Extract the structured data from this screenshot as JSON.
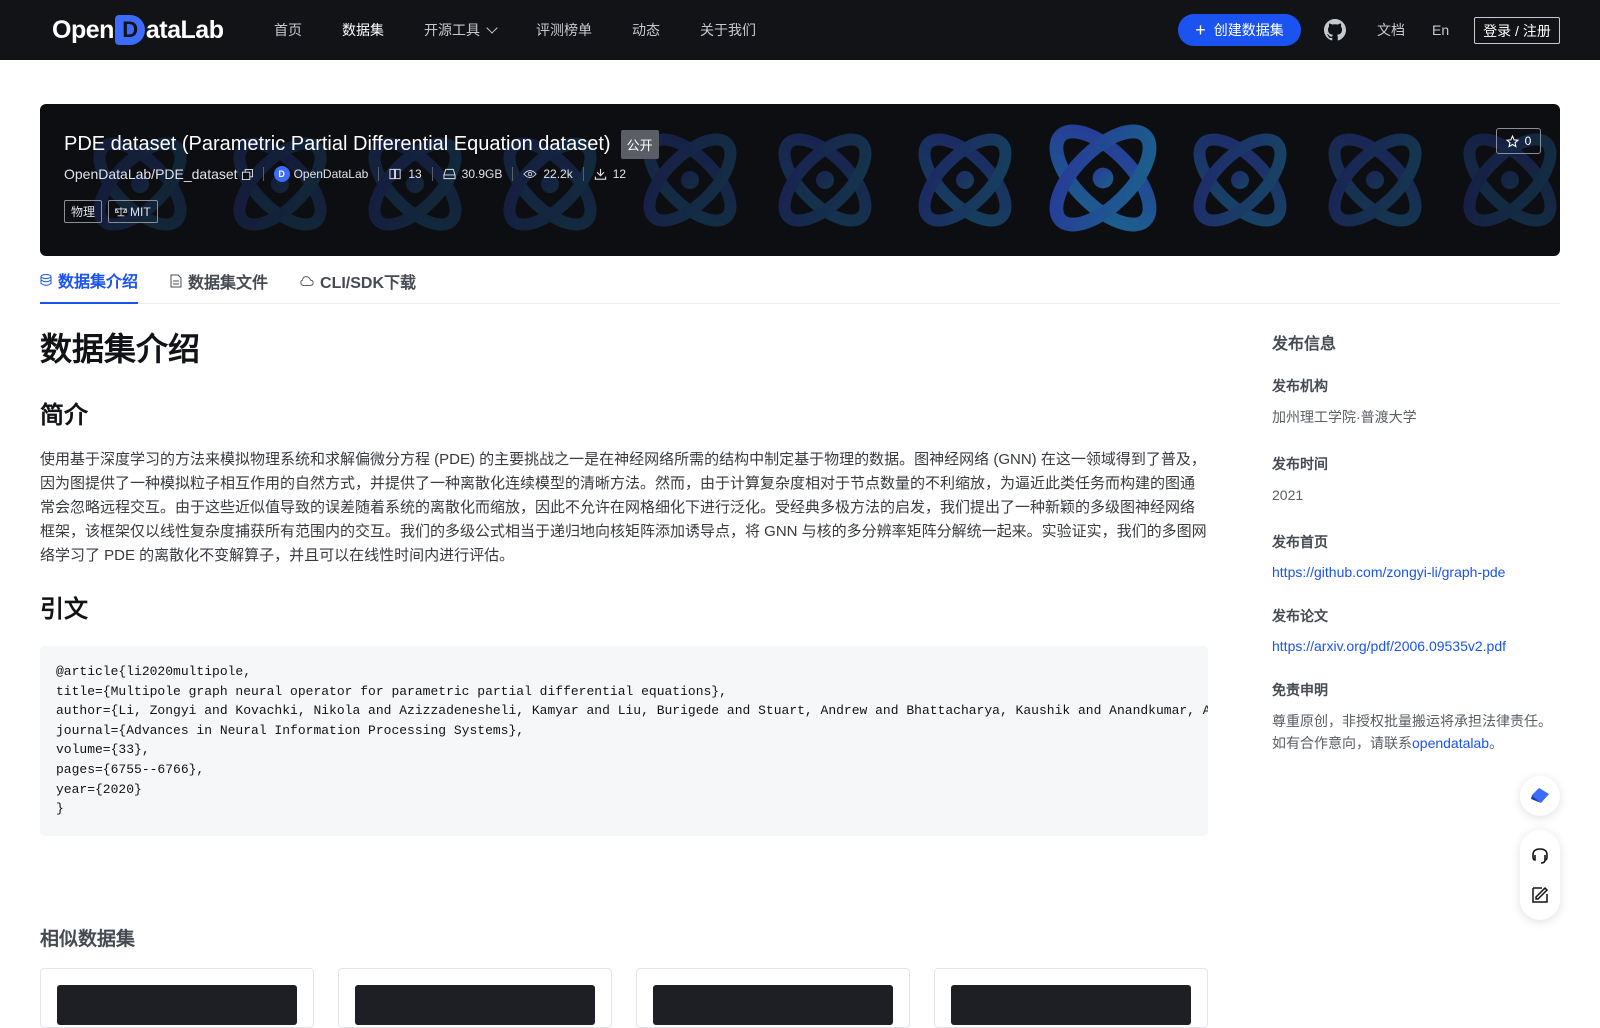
{
  "brand": {
    "logo_pre": "Open",
    "logo_mark": "D",
    "logo_post": "ataLab"
  },
  "nav": {
    "items": [
      {
        "label": "首页",
        "active": false
      },
      {
        "label": "数据集",
        "active": true
      },
      {
        "label": "开源工具",
        "active": false,
        "dropdown": true
      },
      {
        "label": "评测榜单",
        "active": false
      },
      {
        "label": "动态",
        "active": false
      },
      {
        "label": "关于我们",
        "active": false
      }
    ],
    "create_label": "创建数据集",
    "docs_label": "文档",
    "lang_label": "En",
    "login_label": "登录 / 注册"
  },
  "dataset": {
    "title": "PDE dataset (Parametric Partial Differential Equation dataset)",
    "visibility": "公开",
    "repo": "OpenDataLab/PDE_dataset",
    "org": "OpenDataLab",
    "file_count": "13",
    "size": "30.9GB",
    "views": "22.2k",
    "downloads": "12",
    "stars": "0",
    "tags": [
      "物理",
      "MIT"
    ]
  },
  "tabs": [
    {
      "label": "数据集介绍",
      "icon": "database-icon",
      "active": true
    },
    {
      "label": "数据集文件",
      "icon": "file-icon",
      "active": false
    },
    {
      "label": "CLI/SDK下载",
      "icon": "cloud-icon",
      "active": false
    }
  ],
  "main": {
    "heading": "数据集介绍",
    "intro_heading": "简介",
    "intro_text": "使用基于深度学习的方法来模拟物理系统和求解偏微分方程 (PDE) 的主要挑战之一是在神经网络所需的结构中制定基于物理的数据。图神经网络 (GNN) 在这一领域得到了普及，因为图提供了一种模拟粒子相互作用的自然方式，并提供了一种离散化连续模型的清晰方法。然而，由于计算复杂度相对于节点数量的不利缩放，为逼近此类任务而构建的图通常会忽略远程交互。由于这些近似值导致的误差随着系统的离散化而缩放，因此不允许在网格细化下进行泛化。受经典多极方法的启发，我们提出了一种新颖的多级图神经网络框架，该框架仅以线性复杂度捕获所有范围内的交互。我们的多级公式相当于递归地向核矩阵添加诱导点，将 GNN 与核的多分辨率矩阵分解统一起来。实验证实，我们的多图网络学习了 PDE 的离散化不变解算子，并且可以在线性时间内进行评估。",
    "citation_heading": "引文",
    "citation": "@article{li2020multipole,\ntitle={Multipole graph neural operator for parametric partial differential equations},\nauthor={Li, Zongyi and Kovachki, Nikola and Azizzadenesheli, Kamyar and Liu, Burigede and Stuart, Andrew and Bhattacharya, Kaushik and Anandkumar, Anima},\njournal={Advances in Neural Information Processing Systems},\nvolume={33},\npages={6755--6766},\nyear={2020}\n}",
    "similar_heading": "相似数据集"
  },
  "sidebar": {
    "title": "发布信息",
    "publisher_label": "发布机构",
    "publisher": "加州理工学院·普渡大学",
    "time_label": "发布时间",
    "time": "2021",
    "homepage_label": "发布首页",
    "homepage": "https://github.com/zongyi-li/graph-pde",
    "paper_label": "发布论文",
    "paper": "https://arxiv.org/pdf/2006.09535v2.pdf",
    "disclaimer_label": "免责申明",
    "disclaimer_text": "尊重原创，非授权批量搬运将承担法律责任。如有合作意向，请联系",
    "disclaimer_link": "opendatalab",
    "disclaimer_end": "。"
  },
  "colors": {
    "accent": "#1a53f0",
    "nav_bg": "#121316",
    "banner_bg": "#0d0e12"
  }
}
